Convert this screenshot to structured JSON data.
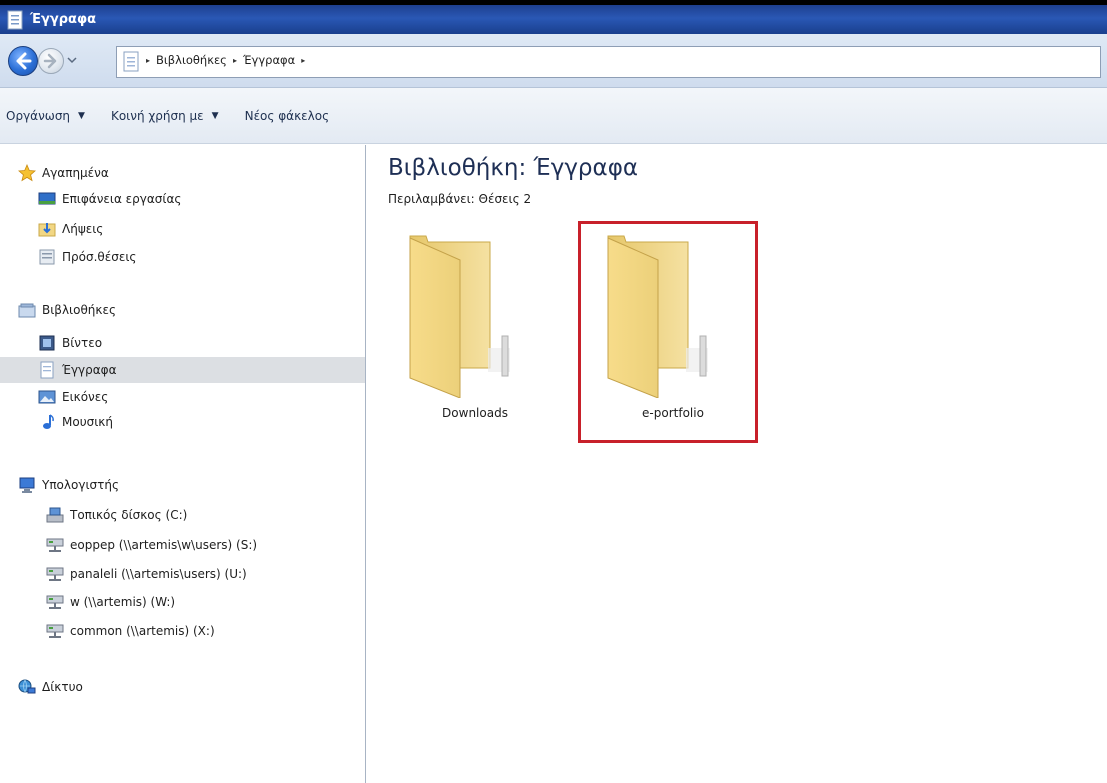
{
  "window": {
    "title": "Έγγραφα"
  },
  "address": {
    "crumbs": [
      "Βιβλιοθήκες",
      "Έγγραφα"
    ]
  },
  "toolbar": {
    "organize_label": "Οργάνωση",
    "share_label": "Κοινή χρήση με",
    "new_folder_label": "Νέος φάκελος"
  },
  "nav": {
    "favorites": {
      "label": "Αγαπημένα",
      "items": [
        "Επιφάνεια εργασίας",
        "Λήψεις",
        "Πρόσ.θέσεις"
      ]
    },
    "libraries": {
      "label": "Βιβλιοθήκες",
      "items": [
        "Βίντεο",
        "Έγγραφα",
        "Εικόνες",
        "Μουσική"
      ]
    },
    "computer": {
      "label": "Υπολογιστής",
      "items": [
        "Τοπικός δίσκος (C:)",
        "eoppep (\\\\artemis\\w\\users) (S:)",
        "panaleli (\\\\artemis\\users) (U:)",
        "w (\\\\artemis) (W:)",
        "common (\\\\artemis) (X:)"
      ]
    },
    "network": {
      "label": "Δίκτυο"
    }
  },
  "content": {
    "title": "Βιβλιοθήκη: Έγγραφα",
    "subtitle": "Περιλαμβάνει: Θέσεις 2",
    "folders": [
      "Downloads",
      "e-portfolio"
    ]
  },
  "colors": {
    "highlight": "#c8202a",
    "folder": "#f2d784",
    "titlebar": "#2a58b5"
  }
}
